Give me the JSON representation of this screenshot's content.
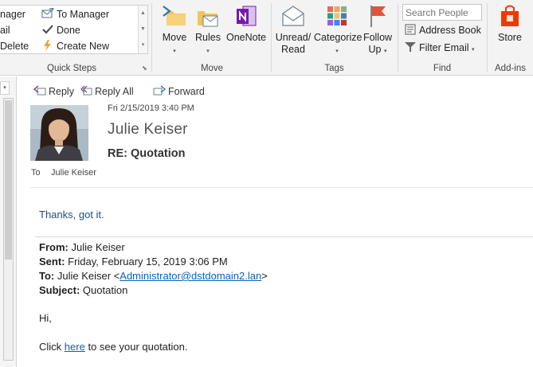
{
  "ribbon": {
    "quick_steps": {
      "items": [
        "nager",
        "To Manager",
        "ail",
        "Done",
        "Delete",
        "Create New"
      ],
      "label": "Quick Steps"
    },
    "move": {
      "move_label": "Move",
      "rules_label": "Rules",
      "onenote_label": "OneNote",
      "label": "Move"
    },
    "tags": {
      "unread_line1": "Unread/",
      "unread_line2": "Read",
      "categorize_label": "Categorize",
      "follow_line1": "Follow",
      "follow_line2": "Up",
      "label": "Tags"
    },
    "find": {
      "search_placeholder": "Search People",
      "address_book_label": "Address Book",
      "filter_email_label": "Filter Email",
      "label": "Find"
    },
    "addins": {
      "store_label": "Store",
      "label": "Add-ins"
    }
  },
  "message": {
    "actions": {
      "reply": "Reply",
      "reply_all": "Reply All",
      "forward": "Forward"
    },
    "date": "Fri 2/15/2019 3:40 PM",
    "sender": "Julie Keiser",
    "subject": "RE: Quotation",
    "to_label": "To",
    "to_name": "Julie Keiser",
    "body": {
      "reply_text": "Thanks, got it.",
      "from_label": "From:",
      "from_value": "Julie Keiser",
      "sent_label": "Sent:",
      "sent_value": "Friday, February 15, 2019 3:06 PM",
      "to_label": "To:",
      "to_value_prefix": "Julie Keiser <",
      "to_email": "Administrator@dstdomain2.lan",
      "to_value_suffix": ">",
      "subject_label": "Subject:",
      "subject_value": "Quotation",
      "greeting": "Hi,",
      "click_prefix": "Click",
      "link_text": "here",
      "click_suffix": "to see your quotation."
    }
  },
  "colors": {
    "accent_blue": "#0563c1",
    "store_orange": "#eb3c00",
    "onenote_purple": "#7719aa"
  }
}
